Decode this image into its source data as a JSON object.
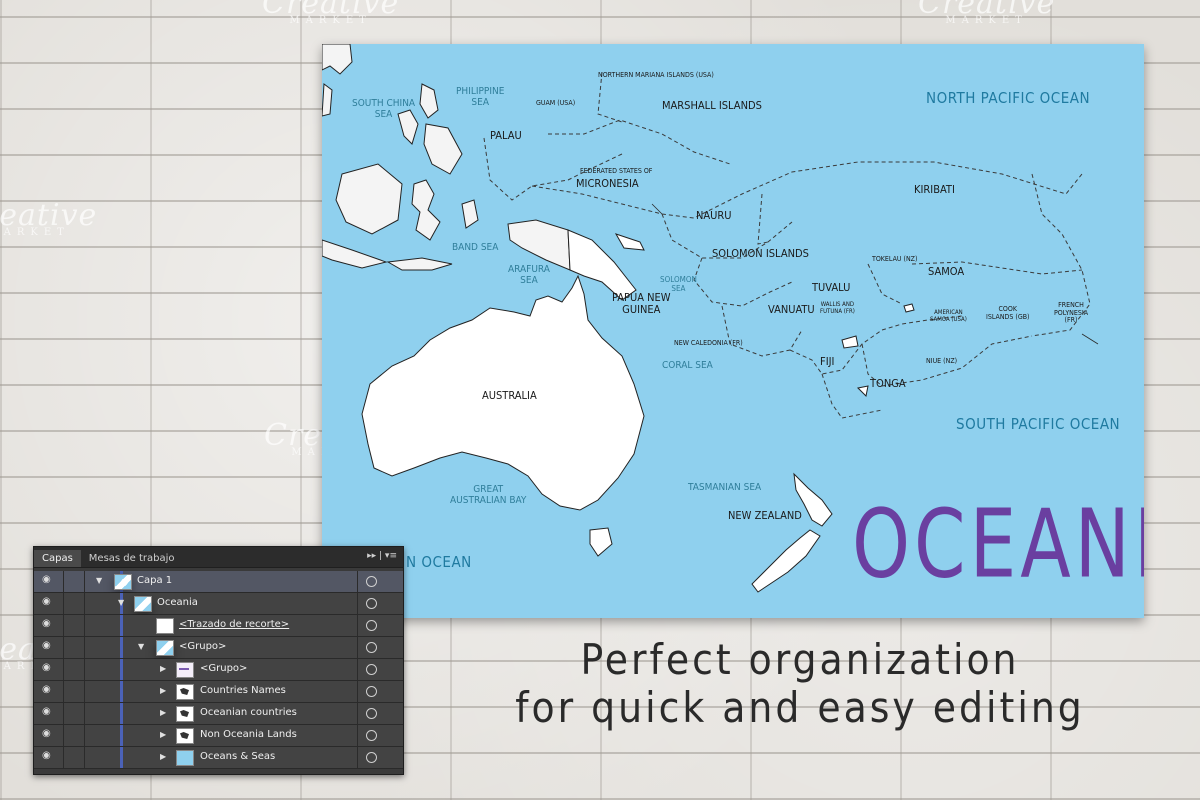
{
  "watermark": {
    "brand": "Creative",
    "sub": "MARKET"
  },
  "map": {
    "countries": [
      {
        "id": "australia",
        "text": "AUSTRALIA"
      },
      {
        "id": "papua",
        "text": "PAPUA NEW\nGUINEA"
      },
      {
        "id": "palau",
        "text": "PALAU"
      },
      {
        "id": "marshall",
        "text": "MARSHALL ISLANDS"
      },
      {
        "id": "micronesia",
        "text": "MICRONESIA"
      },
      {
        "id": "micronesia_pre",
        "text": "FEDERATED STATES OF"
      },
      {
        "id": "nauru",
        "text": "NAURU"
      },
      {
        "id": "kiribati",
        "text": "KIRIBATI"
      },
      {
        "id": "solomon",
        "text": "SOLOMON ISLANDS"
      },
      {
        "id": "tuvalu",
        "text": "TUVALU"
      },
      {
        "id": "vanuatu",
        "text": "VANUATU"
      },
      {
        "id": "fiji",
        "text": "FIJI"
      },
      {
        "id": "tonga",
        "text": "TONGA"
      },
      {
        "id": "samoa",
        "text": "SAMOA"
      },
      {
        "id": "newzealand",
        "text": "NEW ZEALAND"
      },
      {
        "id": "newcaledonia",
        "text": "NEW CALEDONIA (FR)"
      },
      {
        "id": "cook",
        "text": "COOK\nISLANDS (GB)"
      },
      {
        "id": "frenchpoly",
        "text": "FRENCH\nPOLYNESIA\n(FR)"
      },
      {
        "id": "tokelau",
        "text": "TOKELAU (NZ)"
      },
      {
        "id": "niue",
        "text": "NIUE (NZ)"
      },
      {
        "id": "wallis",
        "text": "WALLIS AND\nFUTUNA (FR)"
      },
      {
        "id": "amsamoa",
        "text": "AMERICAN\nSAMOA (USA)"
      },
      {
        "id": "guam",
        "text": "GUAM (USA)"
      },
      {
        "id": "nmariana",
        "text": "NORTHERN MARIANA ISLANDS (USA)"
      }
    ],
    "seas": [
      {
        "id": "southchina",
        "text": "SOUTH CHINA\nSEA"
      },
      {
        "id": "philippine",
        "text": "PHILIPPINE\nSEA"
      },
      {
        "id": "band",
        "text": "BAND SEA"
      },
      {
        "id": "arafura",
        "text": "ARAFURA\nSEA"
      },
      {
        "id": "solomonsea",
        "text": "SOLOMON\nSEA"
      },
      {
        "id": "coral",
        "text": "CORAL SEA"
      },
      {
        "id": "tasman",
        "text": "TASMANIAN SEA"
      },
      {
        "id": "gab",
        "text": "GREAT\nAUSTRALIAN BAY"
      }
    ],
    "oceans": [
      {
        "id": "npo",
        "text": "NORTH PACIFIC OCEAN"
      },
      {
        "id": "spo",
        "text": "SOUTH PACIFIC OCEAN"
      },
      {
        "id": "indian",
        "text": "N OCEAN"
      }
    ],
    "title": "OCEANIA"
  },
  "tagline": {
    "line1": "Perfect organization",
    "line2": "for quick and easy editing"
  },
  "layers_panel": {
    "tabs": [
      "Capas",
      "Mesas de trabajo"
    ],
    "menu": "▸▸ | ▾≡",
    "rows": [
      {
        "label": "Capa 1"
      },
      {
        "label": "Oceania"
      },
      {
        "label": "<Trazado de recorte>"
      },
      {
        "label": "<Grupo>"
      },
      {
        "label": "<Grupo>"
      },
      {
        "label": "Countries Names"
      },
      {
        "label": "Oceanian countries"
      },
      {
        "label": "Non Oceania Lands"
      },
      {
        "label": "Oceans & Seas"
      }
    ]
  },
  "colors": {
    "ocean": "#8fd0ee",
    "land": "#ffffff",
    "title": "#6a3fa0",
    "panel": "#3a3a3a",
    "selection": "#535764"
  }
}
